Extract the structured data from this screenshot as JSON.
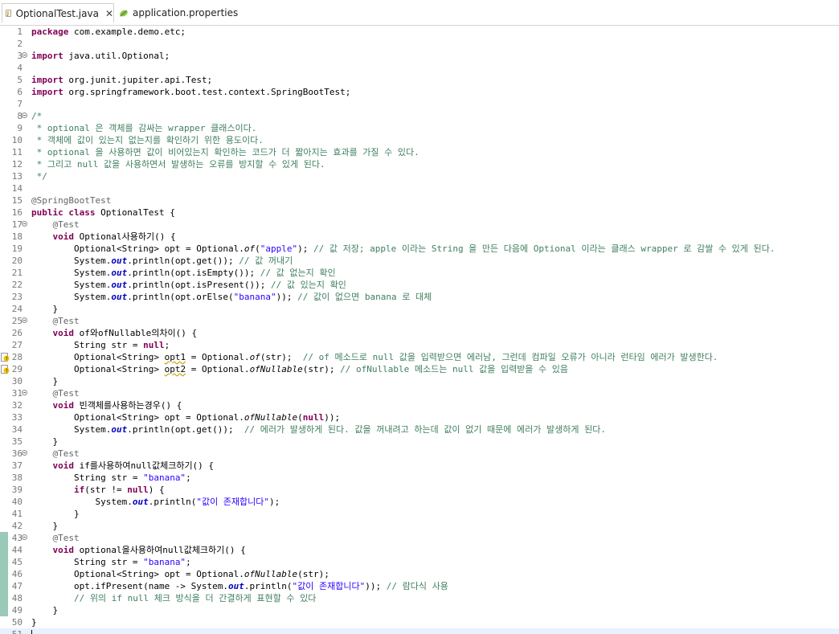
{
  "tabs": [
    {
      "label": "OptionalTest.java",
      "icon": "java-file-icon",
      "active": true
    },
    {
      "label": "application.properties",
      "icon": "spring-leaf-icon",
      "active": false
    }
  ],
  "lines": [
    {
      "n": "1",
      "parts": [
        [
          "kw",
          "package"
        ],
        [
          "",
          "com.example.demo.etc;"
        ]
      ]
    },
    {
      "n": "2",
      "parts": []
    },
    {
      "n": "3",
      "fold": true,
      "parts": [
        [
          "kw",
          "import"
        ],
        [
          "",
          "java.util.Optional;"
        ]
      ]
    },
    {
      "n": "4",
      "parts": []
    },
    {
      "n": "5",
      "parts": [
        [
          "kw",
          "import"
        ],
        [
          "",
          "org.junit.jupiter.api.Test;"
        ]
      ]
    },
    {
      "n": "6",
      "parts": [
        [
          "kw",
          "import"
        ],
        [
          "",
          "org.springframework.boot.test.context.SpringBootTest;"
        ]
      ]
    },
    {
      "n": "7",
      "parts": []
    },
    {
      "n": "8",
      "fold": true,
      "parts": [
        [
          "cm",
          "/*"
        ]
      ]
    },
    {
      "n": "9",
      "parts": [
        [
          "cm",
          " * optional 은 객체를 감싸는 wrapper 클래스이다."
        ]
      ]
    },
    {
      "n": "10",
      "parts": [
        [
          "cm",
          " * 객체에 값이 있는지 없는지를 확인하기 위한 용도이다."
        ]
      ]
    },
    {
      "n": "11",
      "parts": [
        [
          "cm",
          " * optional 을 사용하면 값이 비어있는지 확인하는 코드가 더 짧아지는 효과를 가질 수 있다."
        ]
      ]
    },
    {
      "n": "12",
      "parts": [
        [
          "cm",
          " * 그리고 null 값을 사용하면서 발생하는 오류를 방지할 수 있게 된다."
        ]
      ]
    },
    {
      "n": "13",
      "parts": [
        [
          "cm",
          " */"
        ]
      ]
    },
    {
      "n": "14",
      "parts": []
    },
    {
      "n": "15",
      "parts": [
        [
          "ann",
          "@SpringBootTest"
        ]
      ]
    },
    {
      "n": "16",
      "parts": [
        [
          "kw",
          "public"
        ],
        [
          "kw",
          "class"
        ],
        [
          "",
          "OptionalTest {"
        ]
      ]
    },
    {
      "n": "17",
      "fold": true,
      "parts": [
        [
          "",
          "    "
        ],
        [
          "ann",
          "@Test"
        ]
      ]
    },
    {
      "n": "18",
      "parts": [
        [
          "",
          "    "
        ],
        [
          "kw",
          "void"
        ],
        [
          "",
          "Optional사용하기() {"
        ]
      ]
    },
    {
      "n": "19",
      "parts": [
        [
          "",
          "        Optional<String> opt = Optional."
        ],
        [
          "it",
          "of"
        ],
        [
          "",
          "("
        ],
        [
          "str",
          "\"apple\""
        ],
        [
          "",
          "); "
        ],
        [
          "cm",
          "// 값 저장; apple 이라는 String 을 만든 다음에 Optional 이라는 클래스 wrapper 로 감쌀 수 있게 된다."
        ]
      ]
    },
    {
      "n": "20",
      "parts": [
        [
          "",
          "        System."
        ],
        [
          "st",
          "out"
        ],
        [
          "",
          ".println(opt.get()); "
        ],
        [
          "cm",
          "// 값 꺼내기"
        ]
      ]
    },
    {
      "n": "21",
      "parts": [
        [
          "",
          "        System."
        ],
        [
          "st",
          "out"
        ],
        [
          "",
          ".println(opt.isEmpty()); "
        ],
        [
          "cm",
          "// 값 없는지 확인"
        ]
      ]
    },
    {
      "n": "22",
      "parts": [
        [
          "",
          "        System."
        ],
        [
          "st",
          "out"
        ],
        [
          "",
          ".println(opt.isPresent()); "
        ],
        [
          "cm",
          "// 값 있는지 확인"
        ]
      ]
    },
    {
      "n": "23",
      "parts": [
        [
          "",
          "        System."
        ],
        [
          "st",
          "out"
        ],
        [
          "",
          ".println(opt.orElse("
        ],
        [
          "str",
          "\"banana\""
        ],
        [
          "",
          "));"
        ],
        [
          "cm",
          " // 값이 없으면 banana 로 대체"
        ]
      ]
    },
    {
      "n": "24",
      "parts": [
        [
          "",
          "    }"
        ]
      ]
    },
    {
      "n": "25",
      "fold": true,
      "parts": [
        [
          "",
          "    "
        ],
        [
          "ann",
          "@Test"
        ]
      ]
    },
    {
      "n": "26",
      "parts": [
        [
          "",
          "    "
        ],
        [
          "kw",
          "void"
        ],
        [
          "",
          "of와ofNullable의차이() {"
        ]
      ]
    },
    {
      "n": "27",
      "parts": [
        [
          "",
          "        String str = "
        ],
        [
          "kw",
          "null"
        ],
        [
          "",
          ";"
        ]
      ]
    },
    {
      "n": "28",
      "warn": true,
      "parts": [
        [
          "",
          "        Optional<String> "
        ],
        [
          "wsq",
          "opt1"
        ],
        [
          "",
          " = Optional."
        ],
        [
          "it",
          "of"
        ],
        [
          "",
          "(str);  "
        ],
        [
          "cm",
          "// of 메소드로 null 값을 입력받으면 에러남, 그런데 컴파일 오류가 아니라 런타임 에러가 발생한다."
        ]
      ]
    },
    {
      "n": "29",
      "warn": true,
      "parts": [
        [
          "",
          "        Optional<String> "
        ],
        [
          "wsq",
          "opt2"
        ],
        [
          "",
          " = Optional."
        ],
        [
          "it",
          "ofNullable"
        ],
        [
          "",
          "(str); "
        ],
        [
          "cm",
          "// ofNullable 메소드는 null 값을 입력받을 수 있음"
        ]
      ]
    },
    {
      "n": "30",
      "parts": [
        [
          "",
          "    }"
        ]
      ]
    },
    {
      "n": "31",
      "fold": true,
      "parts": [
        [
          "",
          "    "
        ],
        [
          "ann",
          "@Test"
        ]
      ]
    },
    {
      "n": "32",
      "parts": [
        [
          "",
          "    "
        ],
        [
          "kw",
          "void"
        ],
        [
          "",
          "빈객체를사용하는경우() {"
        ]
      ]
    },
    {
      "n": "33",
      "parts": [
        [
          "",
          "        Optional<String> opt = Optional."
        ],
        [
          "it",
          "ofNullable"
        ],
        [
          "",
          "("
        ],
        [
          "kw",
          "null"
        ],
        [
          "",
          "));"
        ]
      ]
    },
    {
      "n": "34",
      "parts": [
        [
          "",
          "        System."
        ],
        [
          "st",
          "out"
        ],
        [
          "",
          ".println(opt.get());  "
        ],
        [
          "cm",
          "// 에러가 발생하게 된다. 값을 꺼내려고 하는데 값이 없기 때문에 에러가 발생하게 된다."
        ]
      ]
    },
    {
      "n": "35",
      "parts": [
        [
          "",
          "    }"
        ]
      ]
    },
    {
      "n": "36",
      "fold": true,
      "parts": [
        [
          "",
          "    "
        ],
        [
          "ann",
          "@Test"
        ]
      ]
    },
    {
      "n": "37",
      "parts": [
        [
          "",
          "    "
        ],
        [
          "kw",
          "void"
        ],
        [
          "",
          "if를사용하여null값체크하기() {"
        ]
      ]
    },
    {
      "n": "38",
      "parts": [
        [
          "",
          "        String str = "
        ],
        [
          "str",
          "\"banana\""
        ],
        [
          "",
          ";"
        ]
      ]
    },
    {
      "n": "39",
      "parts": [
        [
          "",
          "        "
        ],
        [
          "kw",
          "if"
        ],
        [
          "",
          "(str != "
        ],
        [
          "kw",
          "null"
        ],
        [
          "",
          ") {"
        ]
      ]
    },
    {
      "n": "40",
      "parts": [
        [
          "",
          "            System."
        ],
        [
          "st",
          "out"
        ],
        [
          "",
          ".println("
        ],
        [
          "str",
          "\"값이 존재합니다\""
        ],
        [
          "",
          ");"
        ]
      ]
    },
    {
      "n": "41",
      "parts": [
        [
          "",
          "        }"
        ]
      ]
    },
    {
      "n": "42",
      "parts": [
        [
          "",
          "    }"
        ]
      ]
    },
    {
      "n": "43",
      "fold": true,
      "change": true,
      "parts": [
        [
          "",
          "    "
        ],
        [
          "ann",
          "@Test"
        ]
      ]
    },
    {
      "n": "44",
      "change": true,
      "parts": [
        [
          "",
          "    "
        ],
        [
          "kw",
          "void"
        ],
        [
          "",
          "optional을사용하여null값체크하기() {"
        ]
      ]
    },
    {
      "n": "45",
      "change": true,
      "parts": [
        [
          "",
          "        String str = "
        ],
        [
          "str",
          "\"banana\""
        ],
        [
          "",
          ";"
        ]
      ]
    },
    {
      "n": "46",
      "change": true,
      "parts": [
        [
          "",
          "        Optional<String> opt = Optional."
        ],
        [
          "it",
          "ofNullable"
        ],
        [
          "",
          "(str);"
        ]
      ]
    },
    {
      "n": "47",
      "change": true,
      "parts": [
        [
          "",
          "        opt.ifPresent(name -> System."
        ],
        [
          "st",
          "out"
        ],
        [
          "",
          ".println("
        ],
        [
          "str",
          "\"값이 존재합니다\""
        ],
        [
          "",
          "));"
        ],
        [
          "cm",
          " // 람다식 사용"
        ]
      ]
    },
    {
      "n": "48",
      "change": true,
      "parts": [
        [
          "",
          "        "
        ],
        [
          "cm",
          "// 위의 if null 체크 방식을 더 간결하게 표현할 수 있다"
        ]
      ]
    },
    {
      "n": "49",
      "change": true,
      "parts": [
        [
          "",
          "    }"
        ]
      ]
    },
    {
      "n": "50",
      "parts": [
        [
          "",
          "}"
        ]
      ]
    },
    {
      "n": "51",
      "current": true,
      "caret": true,
      "parts": []
    }
  ]
}
